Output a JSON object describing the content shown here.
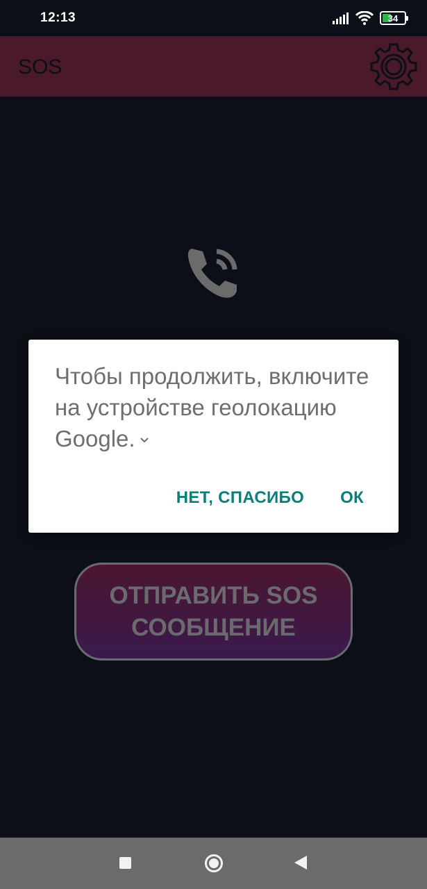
{
  "status_bar": {
    "time": "12:13",
    "battery_level": "34",
    "icons": [
      "signal-icon",
      "wifi-icon",
      "battery-icon"
    ]
  },
  "app_bar": {
    "title": "SOS",
    "settings_icon": "gear-icon",
    "color": "#4a1a2a"
  },
  "main": {
    "call_icon": "phone-call-icon",
    "sos_button_label": "ОТПРАВИТЬ SOS СООБЩЕНИЕ"
  },
  "dialog": {
    "message": "Чтобы продолжить, включите на устройстве геолокацию Google.",
    "expand_icon": "chevron-down-icon",
    "buttons": {
      "negative": "НЕТ, СПАСИБО",
      "positive": "ОК"
    },
    "accent_color": "#0a7f7a"
  },
  "nav_bar": {
    "icons": [
      "recents-square-icon",
      "home-circle-icon",
      "back-triangle-icon"
    ]
  }
}
